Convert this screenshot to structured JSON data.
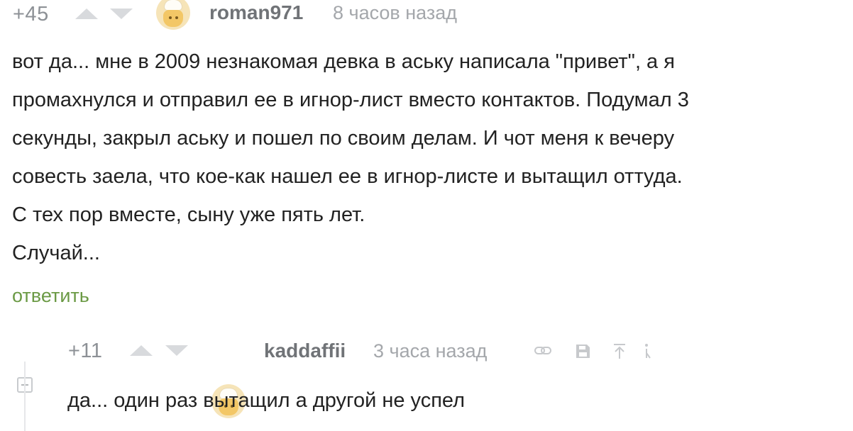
{
  "comments": [
    {
      "rating": "+45",
      "username": "roman971",
      "time": "8 часов назад",
      "lines": [
        "вот да... мне в 2009 незнакомая девка в аську написала \"привет\", а я",
        "промахнулся и отправил ее в игнор-лист вместо контактов. Подумал 3",
        "секунды, закрыл аську и пошел по своим делам. И чот меня к вечеру",
        "совесть заела, что кое-как нашел ее в игнор-листе и вытащил оттуда.",
        "С тех пор вместе, сыну уже пять лет.",
        "Случай..."
      ],
      "reply_label": "ответить"
    },
    {
      "rating": "+11",
      "username": "kaddaffii",
      "time": "3 часа назад",
      "lines": [
        "да... один раз вытащил а другой не успел"
      ]
    }
  ],
  "icons": {
    "upvote": "arrow-up-icon",
    "downvote": "arrow-down-icon",
    "link": "link-icon",
    "save": "save-icon",
    "to_parent": "arrow-to-top-icon",
    "more": "more-icon",
    "collapse": "collapse-minus-icon"
  },
  "colors": {
    "reply_link": "#6b9a45",
    "muted": "#8d9196",
    "arrow": "#d8dadd"
  }
}
